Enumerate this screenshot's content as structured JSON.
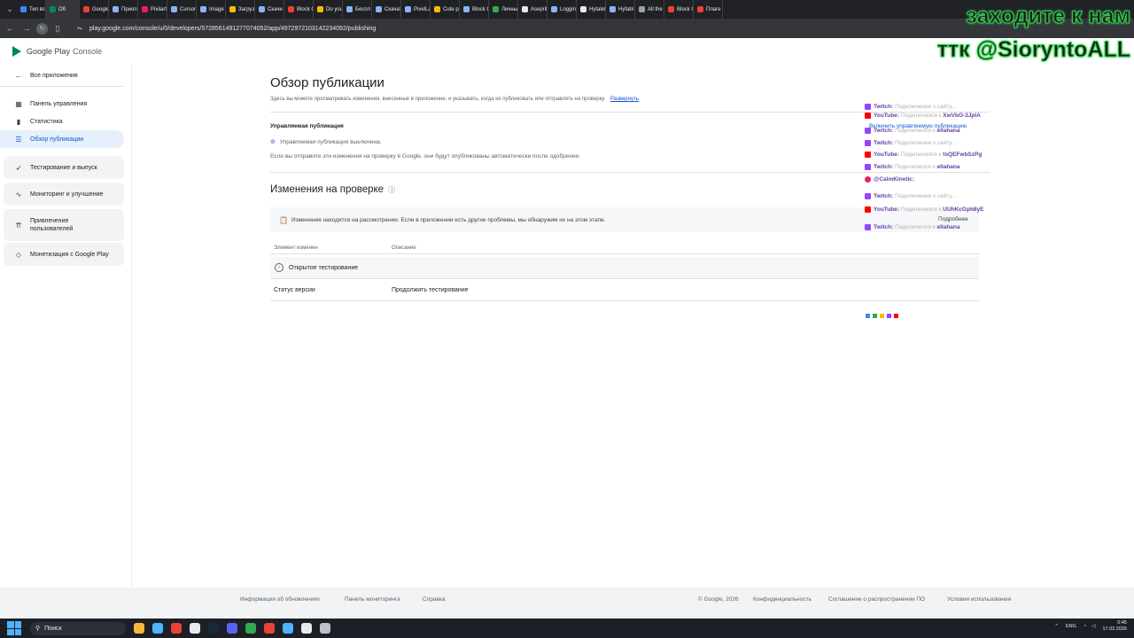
{
  "tabs": [
    {
      "label": "Тип вс",
      "color": "#4285f4"
    },
    {
      "label": "Об",
      "color": "#01875f",
      "active": true
    },
    {
      "label": "Google",
      "color": "#ea4335"
    },
    {
      "label": "Приоп",
      "color": "#8ab4f8"
    },
    {
      "label": "Pixilart",
      "color": "#e91e63"
    },
    {
      "label": "Cursor",
      "color": "#8ab4f8"
    },
    {
      "label": "Image",
      "color": "#8ab4f8"
    },
    {
      "label": "Загруз",
      "color": "#fbbc04"
    },
    {
      "label": "Скачи",
      "color": "#8ab4f8"
    },
    {
      "label": "Block C",
      "color": "#ea4335"
    },
    {
      "label": "Do you",
      "color": "#fbbc04"
    },
    {
      "label": "Беспл",
      "color": "#8ab4f8"
    },
    {
      "label": "Скачат",
      "color": "#8ab4f8"
    },
    {
      "label": "PixelLa",
      "color": "#8ab4f8"
    },
    {
      "label": "Cute p",
      "color": "#fbbc04"
    },
    {
      "label": "Block C",
      "color": "#8ab4f8"
    },
    {
      "label": "Личны",
      "color": "#34a853"
    },
    {
      "label": "Aseprit",
      "color": "#e8eaed"
    },
    {
      "label": "Loggin",
      "color": "#8ab4f8"
    },
    {
      "label": "Hytalet",
      "color": "#e8eaed"
    },
    {
      "label": "Hyfabl",
      "color": "#8ab4f8"
    },
    {
      "label": "All the",
      "color": "#9aa0a6"
    },
    {
      "label": "Block C",
      "color": "#ea4335"
    },
    {
      "label": "Плаге",
      "color": "#ea4335"
    }
  ],
  "browser": {
    "url": "play.google.com/console/u/0/developers/5728561491277074052/app/4972972103142234092/publishing"
  },
  "logo": {
    "brand": "Google Play",
    "product": "Console"
  },
  "sidebar": {
    "back": "Все приложения",
    "items": [
      {
        "label": "Панель управления",
        "icon": "dashboard-icon"
      },
      {
        "label": "Статистика",
        "icon": "bar-chart-icon"
      },
      {
        "label": "Обзор публикации",
        "icon": "publishing-overview-icon",
        "active": true
      }
    ],
    "groups": [
      {
        "label": "Тестирование и выпуск",
        "icon": "rocket-icon"
      },
      {
        "label": "Мониторинг и улучшение",
        "icon": "pulse-icon"
      },
      {
        "label": "Привлечение\nпользователей",
        "icon": "growth-icon"
      },
      {
        "label": "Монетизация с Google Play",
        "icon": "tag-icon"
      }
    ]
  },
  "main": {
    "title": "Обзор публикации",
    "subtitle": "Здесь вы можете просматривать изменения, внесенные в приложение, и указывать, когда их публиковать или отправлять на проверку.",
    "expand_link": "Развернуть",
    "managed": {
      "heading": "Управляемая публикация",
      "enable_link": "Включить управляемую публикацию",
      "status": "Управляемая публикация выключена.",
      "note": "Если вы отправите эти изменения на проверку в Google, они будут опубликованы автоматически после одобрения."
    },
    "review": {
      "heading": "Изменения на проверке",
      "notice": "Изменения находятся на рассмотрении. Если в приложении есть другие проблемы, мы обнаружим их на этом этапе.",
      "details": "Подробнее",
      "columns": [
        "Элемент изменен",
        "Описание"
      ],
      "rows": [
        {
          "element": "Открытое тестирование",
          "description": ""
        },
        {
          "element": "Статус версии",
          "description": "Продолжить тестирование"
        }
      ]
    }
  },
  "footer": {
    "links_left": [
      "Информация об обновлениях",
      "Панель мониторинга",
      "Справка"
    ],
    "copyright": "© Google, 2026",
    "links_right": [
      "Конфиденциальность",
      "Соглашение о распространении ПО",
      "Условия использования"
    ]
  },
  "overlay": {
    "promo_line1": "заходите к нам",
    "promo_line2": "ттк @SiorуntoALL",
    "chat": [
      {
        "platform": "tw",
        "user": "Twitch:",
        "msg": "Подключение к сайту..."
      },
      {
        "platform": "yt",
        "user": "YouTube:",
        "msg": "Подключился к ",
        "target": "XwVbO-3JpIA"
      },
      {
        "platform": "tw",
        "user": "Twitch:",
        "msg": "Подключился к ",
        "target": "ellahana"
      },
      {
        "platform": "tw",
        "user": "Twitch:",
        "msg": "Подключение к сайту..."
      },
      {
        "platform": "yt",
        "user": "YouTube:",
        "msg": "Подключился к ",
        "target": "tsQEFwbSzPg"
      },
      {
        "platform": "tw",
        "user": "Twitch:",
        "msg": "Подключился к ",
        "target": "ellahana"
      },
      {
        "platform": "mt",
        "user": "@CalmKinetic:",
        "msg": "",
        "target": ""
      },
      {
        "platform": "tw",
        "user": "Twitch:",
        "msg": "Подключение к сайту..."
      },
      {
        "platform": "yt",
        "user": "YouTube:",
        "msg": "Подключился к ",
        "target": "UUhKcGph8yE"
      },
      {
        "platform": "tw",
        "user": "Twitch:",
        "msg": "Подключился к ",
        "target": "ellahana"
      }
    ]
  },
  "taskbar": {
    "search": "Поиск",
    "lang": "ENG",
    "time": "0:45",
    "date": "17.02.2026",
    "icons": [
      "#f6b93b",
      "#4fb3ff",
      "#ea4335",
      "#e8eaed",
      "#1b2838",
      "#5865f2",
      "#34a853",
      "#ea4335",
      "#4fb3ff",
      "#e8eaed",
      "#bdc1c6"
    ]
  }
}
